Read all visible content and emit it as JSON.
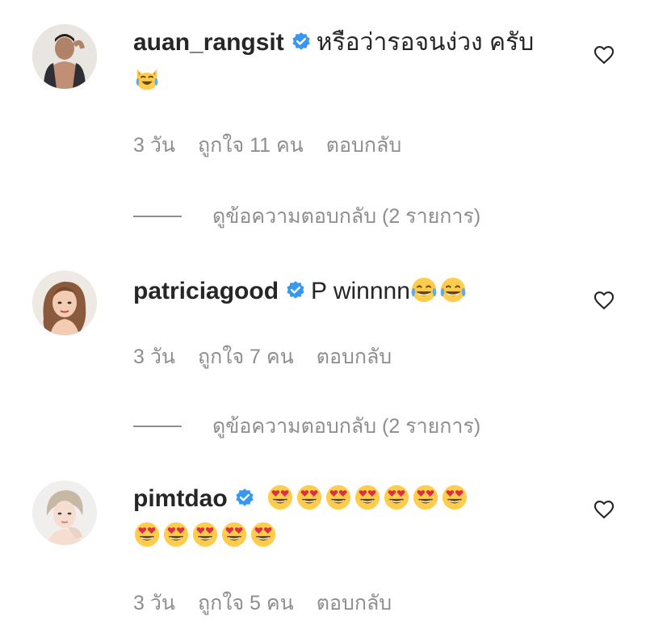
{
  "comments": [
    {
      "username": "auan_rangsit",
      "verified": true,
      "text": "หรือว่ารอจนง่วง ครับ",
      "emojis": [
        "cat-tears-of-joy"
      ],
      "time": "3 วัน",
      "likes": "ถูกใจ 11 คน",
      "reply": "ตอบกลับ",
      "view_replies": "ดูข้อความตอบกลับ (2 รายการ)"
    },
    {
      "username": "patriciagood",
      "verified": true,
      "text": "P winnnn",
      "emojis": [
        "face-with-tears-of-joy",
        "face-with-tears-of-joy"
      ],
      "time": "3 วัน",
      "likes": "ถูกใจ 7 คน",
      "reply": "ตอบกลับ",
      "view_replies": "ดูข้อความตอบกลับ (2 รายการ)"
    },
    {
      "username": "pimtdao",
      "verified": true,
      "text": "",
      "emojis": [
        "heart-eyes",
        "heart-eyes",
        "heart-eyes",
        "heart-eyes",
        "heart-eyes",
        "heart-eyes",
        "heart-eyes",
        "heart-eyes",
        "heart-eyes",
        "heart-eyes",
        "heart-eyes",
        "heart-eyes"
      ],
      "time": "3 วัน",
      "likes": "ถูกใจ 5 คน",
      "reply": "ตอบกลับ"
    }
  ],
  "colors": {
    "text": "#262626",
    "secondary": "#8e8e8e",
    "verified": "#3897f0",
    "emoji_face": "#ffcc4d"
  }
}
